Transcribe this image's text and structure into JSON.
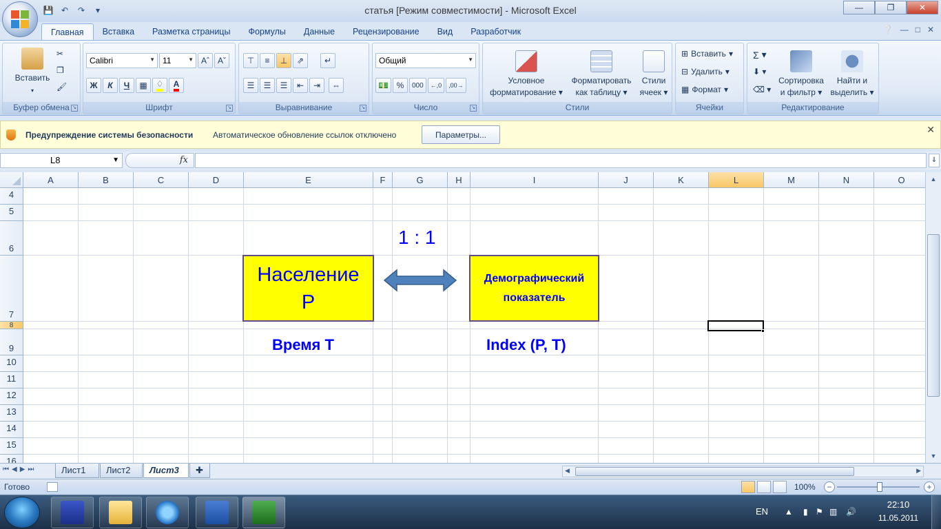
{
  "window": {
    "title": "статья  [Режим совместимости] - Microsoft Excel",
    "min": "—",
    "restore": "❐",
    "close": "✕"
  },
  "tabs": [
    "Главная",
    "Вставка",
    "Разметка страницы",
    "Формулы",
    "Данные",
    "Рецензирование",
    "Вид",
    "Разработчик"
  ],
  "ribbon": {
    "clipboard": {
      "label": "Буфер обмена",
      "paste": "Вставить"
    },
    "font": {
      "label": "Шрифт",
      "name": "Calibri",
      "size": "11",
      "bold": "Ж",
      "italic": "К",
      "underline": "Ч"
    },
    "alignment": {
      "label": "Выравнивание"
    },
    "number": {
      "label": "Число",
      "format": "Общий",
      "percent": "%",
      "thousands": "000"
    },
    "styles": {
      "label": "Стили",
      "conditional_1": "Условное",
      "conditional_2": "форматирование",
      "table_1": "Форматировать",
      "table_2": "как таблицу",
      "cell_1": "Стили",
      "cell_2": "ячеек"
    },
    "cells": {
      "label": "Ячейки",
      "insert": "Вставить",
      "delete": "Удалить",
      "format": "Формат"
    },
    "editing": {
      "label": "Редактирование",
      "sort_1": "Сортировка",
      "sort_2": "и фильтр",
      "find_1": "Найти и",
      "find_2": "выделить",
      "sigma": "Σ"
    }
  },
  "security_bar": {
    "title": "Предупреждение системы безопасности",
    "message": "Автоматическое обновление ссылок отключено",
    "button": "Параметры...",
    "close": "✕"
  },
  "formula_bar": {
    "name_box": "L8",
    "fx": "fx",
    "formula": ""
  },
  "grid": {
    "columns": [
      "A",
      "B",
      "C",
      "D",
      "E",
      "F",
      "G",
      "H",
      "I",
      "J",
      "K",
      "L",
      "M",
      "N",
      "O"
    ],
    "selected_column": "L",
    "rows": [
      "4",
      "5",
      "6",
      "7",
      "8",
      "9",
      "10",
      "11",
      "12",
      "13",
      "14",
      "15",
      "16"
    ],
    "selected_cell": "L8"
  },
  "diagram": {
    "ratio": "1 : 1",
    "box_left_line1": "Население",
    "box_left_line2": "P",
    "box_right_line1": "Демографический",
    "box_right_line2": "показатель",
    "label_left": "Время Т",
    "label_right": "Index (P, T)"
  },
  "sheets": {
    "tabs": [
      "Лист1",
      "Лист2",
      "Лист3"
    ],
    "active": "Лист3"
  },
  "status": {
    "text": "Готово",
    "zoom": "100%"
  },
  "taskbar": {
    "lang": "EN",
    "time": "22:10",
    "date": "11.05.2011"
  },
  "colors": {
    "shape_fill": "#ffff00",
    "shape_border": "#5f4b8b",
    "text_blue": "#0000ff",
    "arrow_fill": "#4f81bd"
  }
}
